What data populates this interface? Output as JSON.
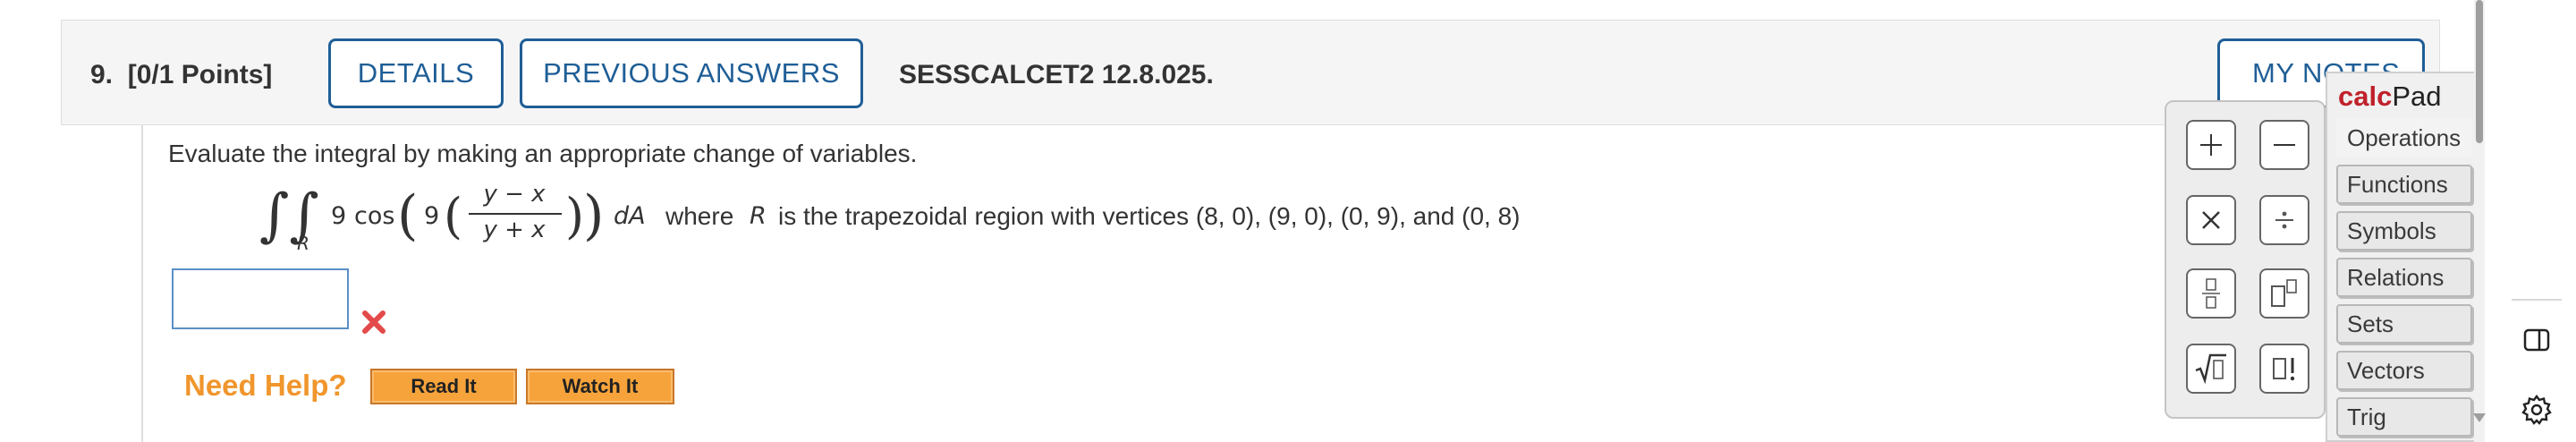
{
  "question": {
    "number": "9.",
    "points": "[0/1 Points]",
    "details_label": "DETAILS",
    "previous_answers_label": "PREVIOUS ANSWERS",
    "code": "SESSCALCET2 12.8.025.",
    "my_notes_label": "MY NOTES",
    "prompt": "Evaluate the integral by making an appropriate change of variables.",
    "math": {
      "integral_sub": "R",
      "coef": "9",
      "func": "cos",
      "inner_coef": "9",
      "numerator": "y − x",
      "denominator": "y + x",
      "differential": "dA",
      "where": "where",
      "region_var": "R",
      "region_text": "is the trapezoidal region with vertices (8, 0), (9, 0), (0, 9), and (0, 8)"
    },
    "answer_value": "",
    "status_icon": "x-icon",
    "status_color": "#e34a4a",
    "need_help_label": "Need Help?",
    "read_it_label": "Read It",
    "watch_it_label": "Watch It"
  },
  "calcpad": {
    "brand": "calc",
    "brand_rest": "Pad",
    "buttons": [
      "+",
      "−",
      "X",
      "÷",
      "fraction",
      "power",
      "sqrt",
      "factorial"
    ],
    "categories": [
      "Operations",
      "Functions",
      "Symbols",
      "Relations",
      "Sets",
      "Vectors",
      "Trig"
    ],
    "active_category": "Operations"
  },
  "colors": {
    "accent": "#1f5e96",
    "help_orange": "#f0962d",
    "button_orange": "#f7a33b",
    "brand_red": "#c0212b"
  }
}
